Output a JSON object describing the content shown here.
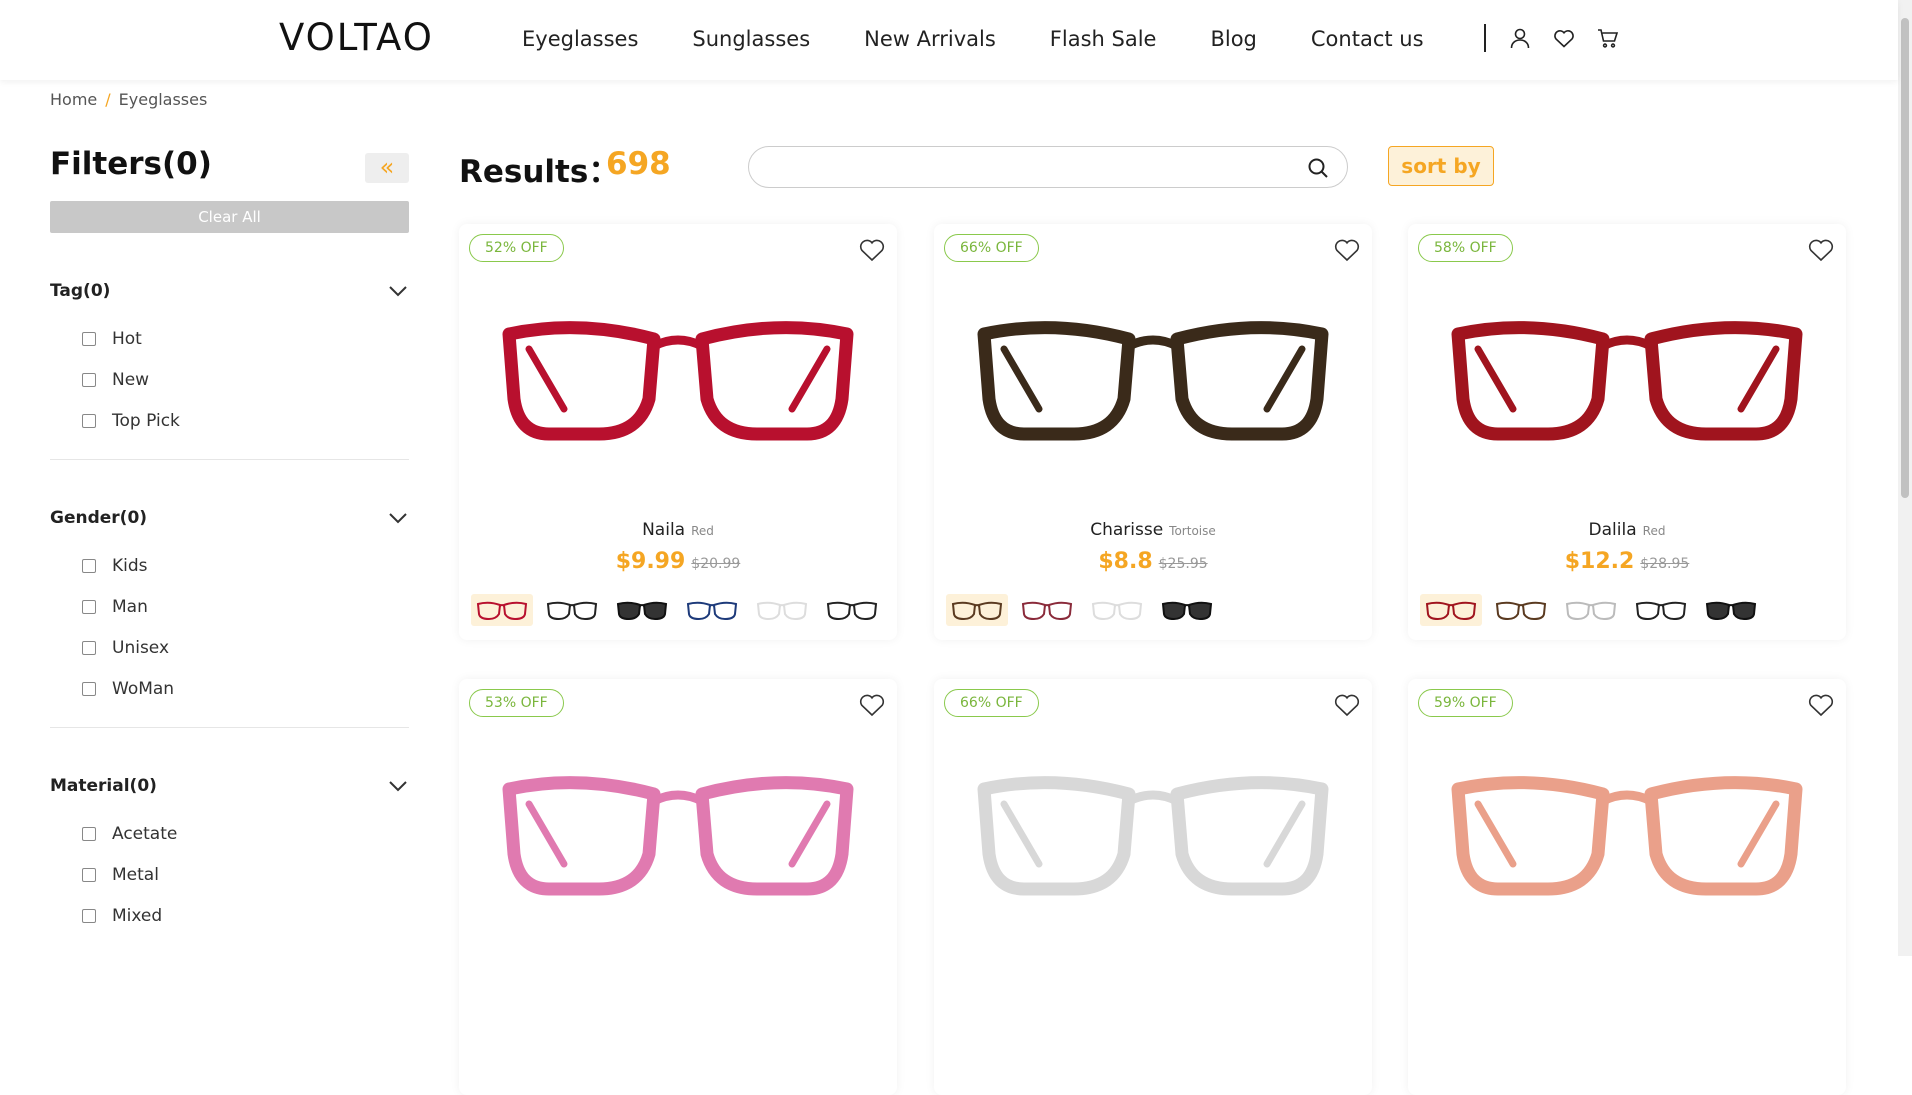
{
  "header": {
    "logo": "VOLTAO",
    "nav": [
      "Eyeglasses",
      "Sunglasses",
      "New Arrivals",
      "Flash Sale",
      "Blog",
      "Contact us"
    ],
    "icons": [
      "user-icon",
      "heart-icon",
      "cart-icon"
    ]
  },
  "breadcrumb": {
    "home": "Home",
    "sep": "/",
    "current": "Eyeglasses"
  },
  "filters": {
    "title": "Filters(0)",
    "collapse": "«",
    "clear": "Clear All",
    "groups": [
      {
        "title": "Tag(0)",
        "options": [
          "Hot",
          "New",
          "Top Pick"
        ]
      },
      {
        "title": "Gender(0)",
        "options": [
          "Kids",
          "Man",
          "Unisex",
          "WoMan"
        ]
      },
      {
        "title": "Material(0)",
        "options": [
          "Acetate",
          "Metal",
          "Mixed"
        ]
      }
    ]
  },
  "results": {
    "label": "Results：",
    "count": "698"
  },
  "search": {
    "placeholder": ""
  },
  "sort": {
    "label": "sort by"
  },
  "colors": {
    "accent": "#f5a623",
    "badge": "#7ab63c"
  },
  "products": [
    {
      "badge": "52% OFF",
      "name": "Naila",
      "color": "Red",
      "price": "$9.99",
      "was": "$20.99",
      "frame": "#b8102e",
      "lens": "none",
      "swatches": [
        "#b8102e",
        "#222222",
        "#111111",
        "#1d3a7a",
        "#dddddd",
        "#222222"
      ]
    },
    {
      "badge": "66% OFF",
      "name": "Charisse",
      "color": "Tortoise",
      "price": "$8.8",
      "was": "$25.95",
      "frame": "#3a2a1a",
      "lens": "none",
      "swatches": [
        "#5a3a20",
        "#8a2a3a",
        "#dddddd",
        "#111111"
      ]
    },
    {
      "badge": "58% OFF",
      "name": "Dalila",
      "color": "Red",
      "price": "$12.2",
      "was": "$28.95",
      "frame": "#a0141e",
      "lens": "none",
      "swatches": [
        "#a0141e",
        "#5a3a20",
        "#bbbbbb",
        "#222222",
        "#111111"
      ]
    },
    {
      "badge": "53% OFF",
      "frame": "#e07ab0",
      "lens": "none"
    },
    {
      "badge": "66% OFF",
      "frame": "#d8d8d8",
      "lens": "none"
    },
    {
      "badge": "59% OFF",
      "frame": "#eaa08a",
      "lens": "none"
    }
  ]
}
